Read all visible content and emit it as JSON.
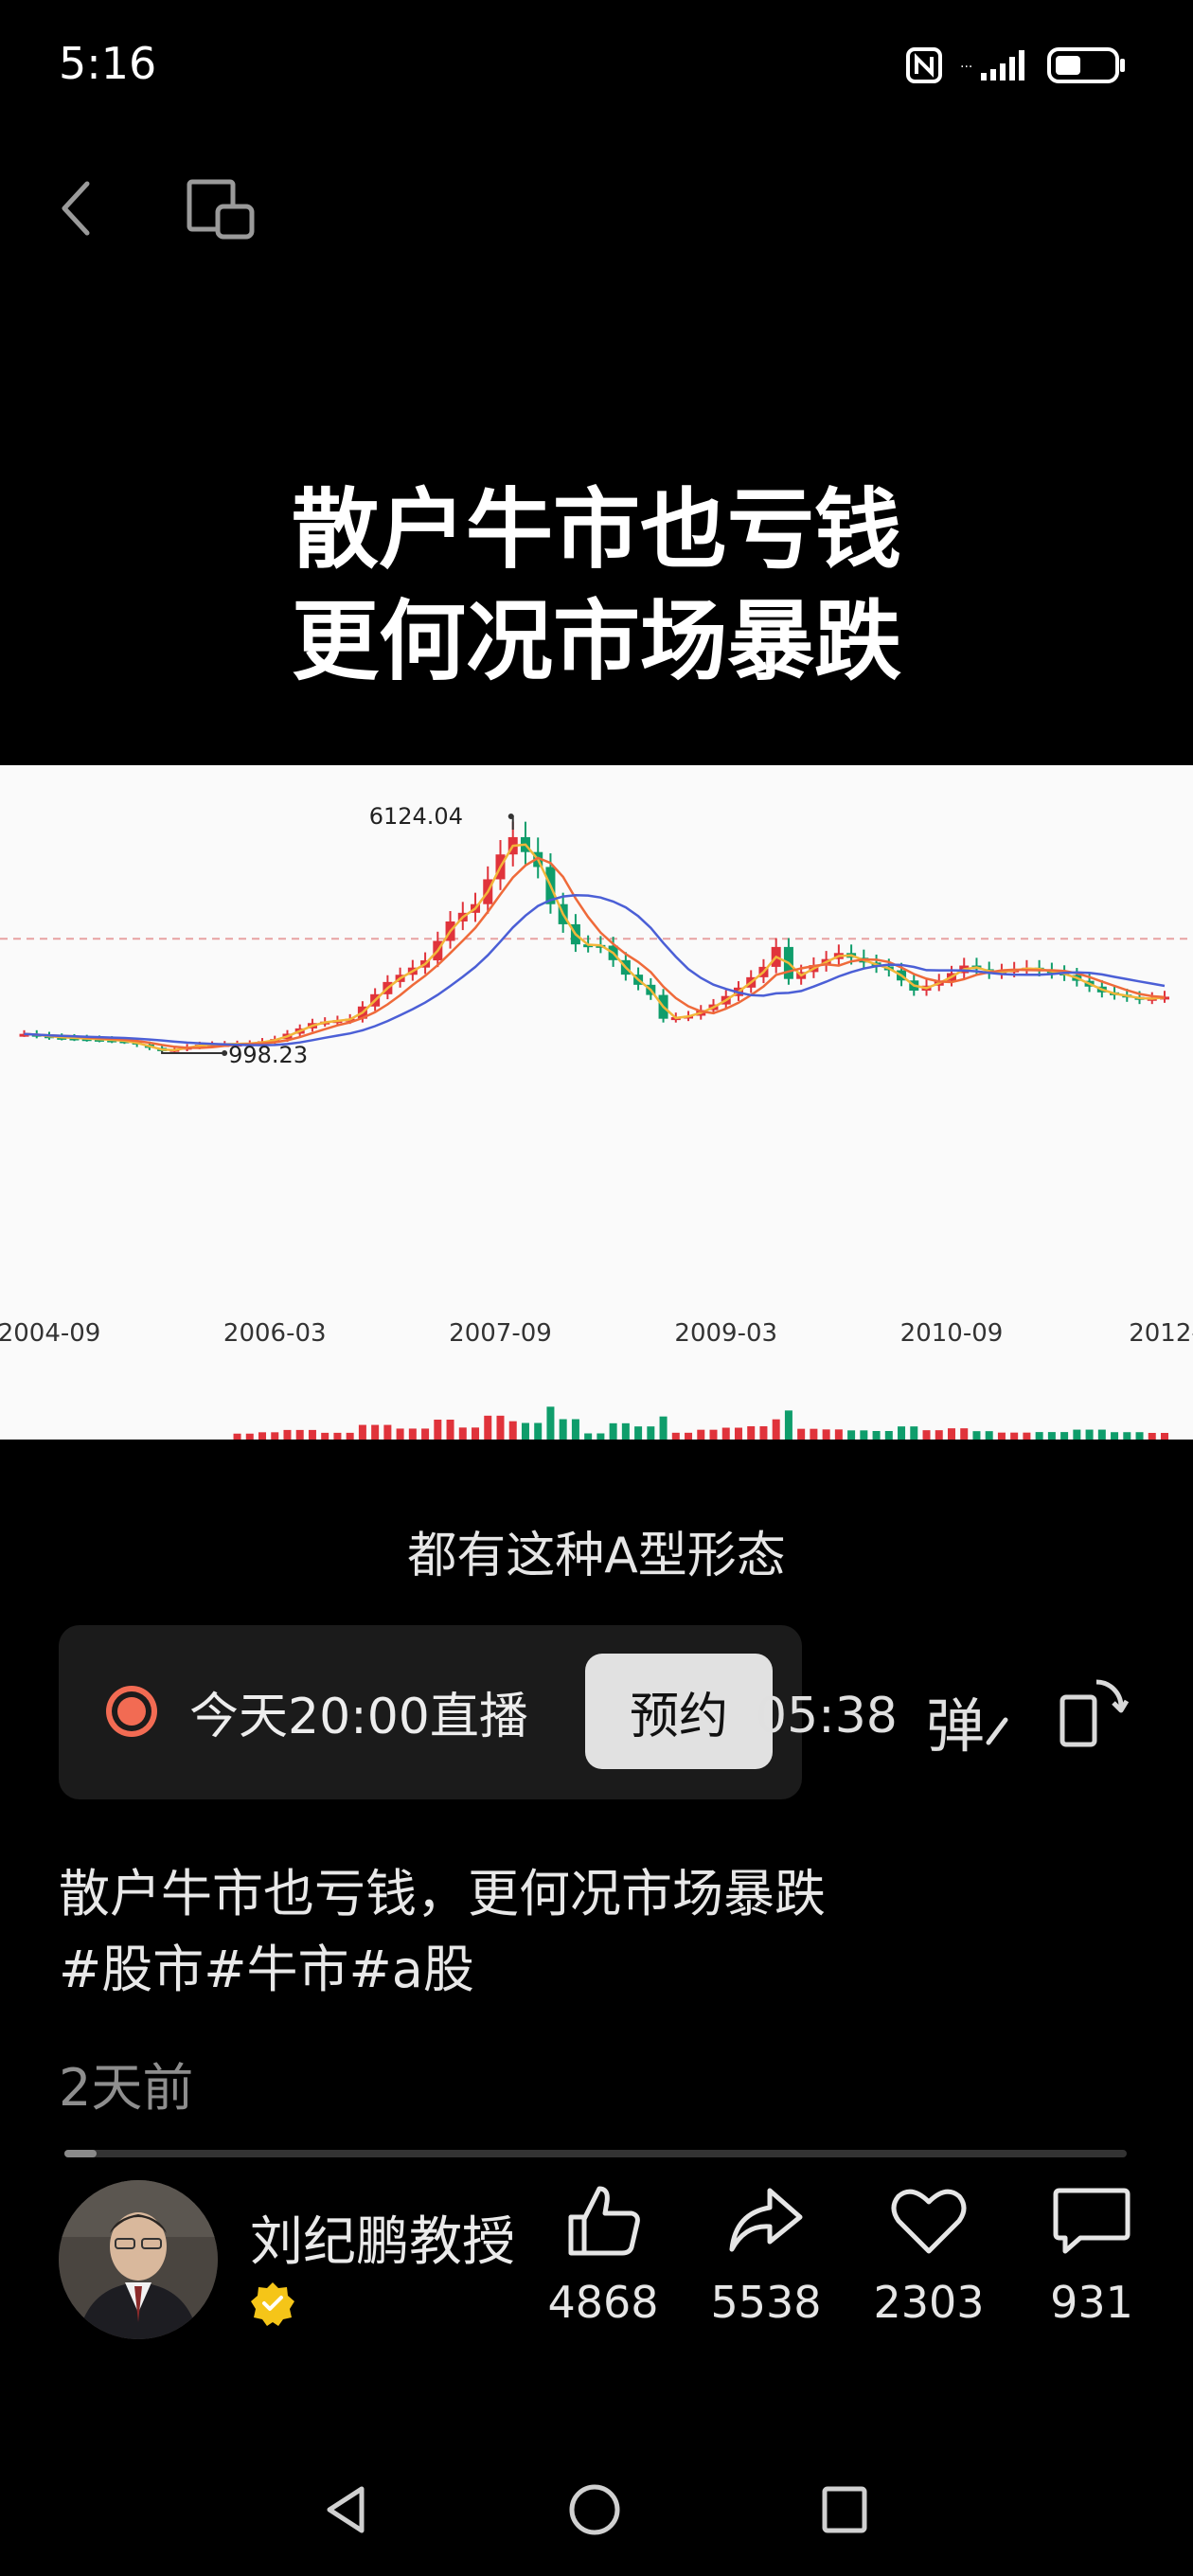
{
  "status_bar": {
    "time": "5:16"
  },
  "video": {
    "title_line1": "散户牛市也亏钱",
    "title_line2": "更何况市场暴跌",
    "caption": "都有这种A型形态"
  },
  "chart_data": {
    "type": "candlestick",
    "x_ticks": [
      "2004-09",
      "2006-03",
      "2007-09",
      "2009-03",
      "2010-09",
      "2012-"
    ],
    "annotations": [
      {
        "label": "6124.04",
        "x": "2007-10",
        "y": 6124.04
      },
      {
        "label": "998.23",
        "x": "2005-06",
        "y": 998.23
      }
    ],
    "series": [
      {
        "type": "candles",
        "color_up": "#e0333b",
        "color_down": "#0f9d6b"
      },
      {
        "type": "ma",
        "color": "#f2b63a"
      },
      {
        "type": "ma",
        "color": "#ef6a3a"
      },
      {
        "type": "ma",
        "color": "#4b5fd6"
      }
    ],
    "close_path": [
      [
        "2004-07",
        1400
      ],
      [
        "2004-09",
        1330
      ],
      [
        "2005-01",
        1270
      ],
      [
        "2005-03",
        1230
      ],
      [
        "2005-06",
        1000
      ],
      [
        "2005-09",
        1150
      ],
      [
        "2006-01",
        1180
      ],
      [
        "2006-03",
        1280
      ],
      [
        "2006-06",
        1650
      ],
      [
        "2006-09",
        1750
      ],
      [
        "2006-12",
        2600
      ],
      [
        "2007-03",
        3100
      ],
      [
        "2007-05",
        4000
      ],
      [
        "2007-07",
        4400
      ],
      [
        "2007-09",
        5550
      ],
      [
        "2007-10",
        5950
      ],
      [
        "2007-12",
        5260
      ],
      [
        "2008-01",
        4400
      ],
      [
        "2008-03",
        3470
      ],
      [
        "2008-05",
        3440
      ],
      [
        "2008-07",
        2770
      ],
      [
        "2008-09",
        2300
      ],
      [
        "2008-10",
        1750
      ],
      [
        "2008-12",
        1820
      ],
      [
        "2009-02",
        2080
      ],
      [
        "2009-04",
        2470
      ],
      [
        "2009-06",
        2950
      ],
      [
        "2009-07",
        3410
      ],
      [
        "2009-08",
        2670
      ],
      [
        "2009-10",
        2990
      ],
      [
        "2009-12",
        3270
      ],
      [
        "2010-02",
        3050
      ],
      [
        "2010-04",
        2870
      ],
      [
        "2010-06",
        2400
      ],
      [
        "2010-08",
        2630
      ],
      [
        "2010-10",
        2980
      ],
      [
        "2010-12",
        2810
      ],
      [
        "2011-03",
        2930
      ],
      [
        "2011-06",
        2760
      ],
      [
        "2011-09",
        2360
      ],
      [
        "2011-12",
        2200
      ],
      [
        "2012-02",
        2260
      ]
    ]
  },
  "live": {
    "text": "今天20:00直播",
    "button": "预约"
  },
  "player": {
    "duration": "05:38",
    "danmu": "弹"
  },
  "description": {
    "line1": "散户牛市也亏钱，更何况市场暴跌",
    "line2": "#股市#牛市#a股",
    "time_ago": "2天前"
  },
  "author": {
    "name": "刘纪鹏教授"
  },
  "stats": {
    "likes": "4868",
    "shares": "5538",
    "favorites": "2303",
    "comments": "931"
  }
}
